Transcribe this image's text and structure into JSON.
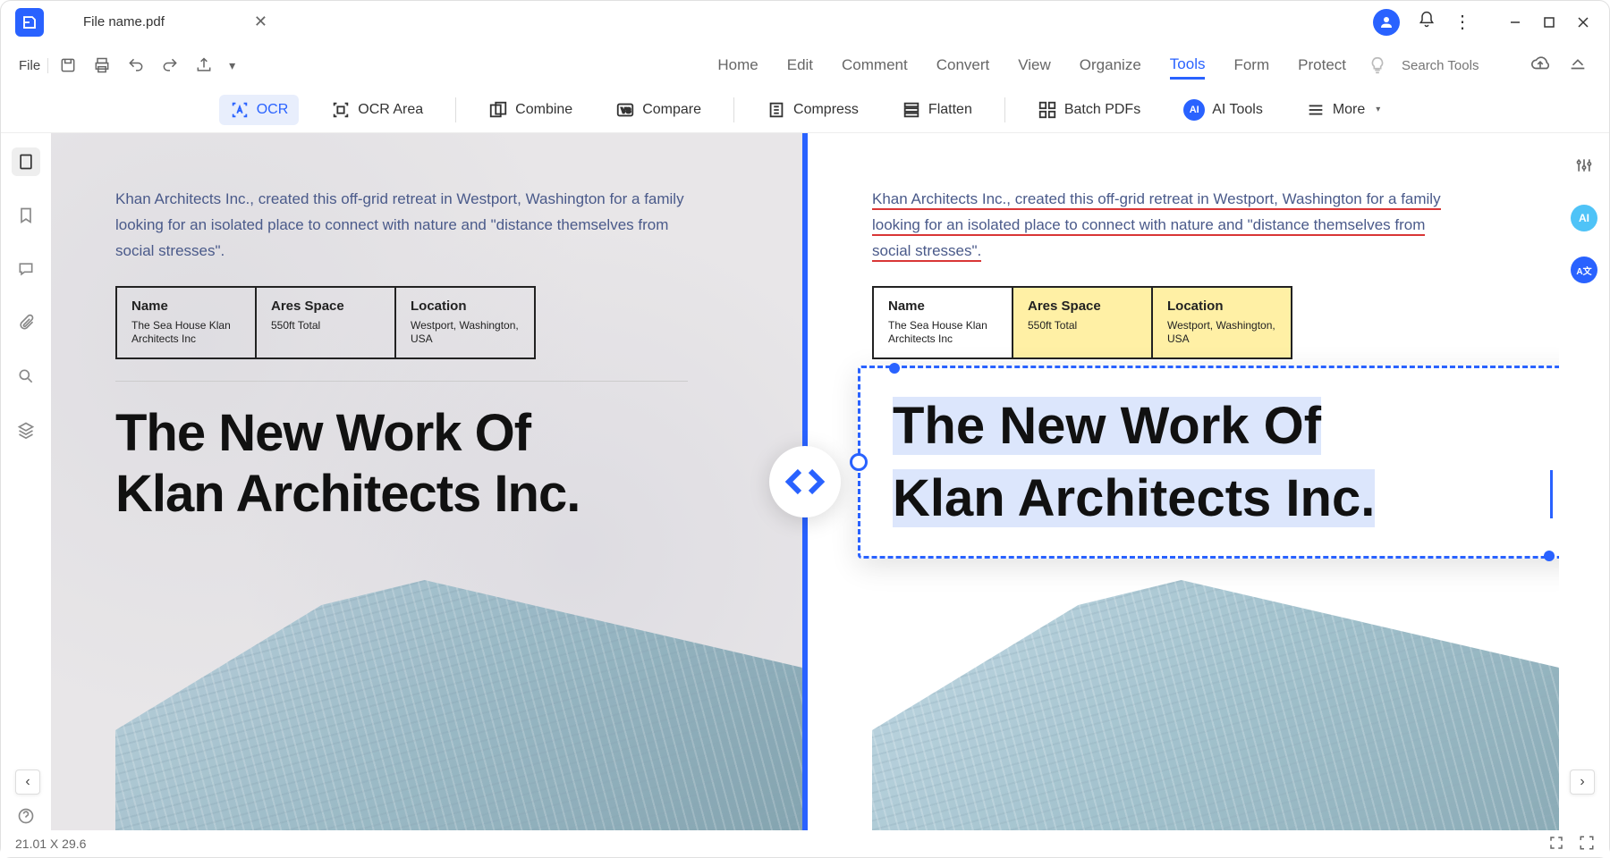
{
  "tab": {
    "filename": "File name.pdf"
  },
  "menubar": {
    "file": "File",
    "items": [
      "Home",
      "Edit",
      "Comment",
      "Convert",
      "View",
      "Organize",
      "Tools",
      "Form",
      "Protect"
    ],
    "active": "Tools",
    "search_placeholder": "Search Tools"
  },
  "toolbar": {
    "ocr": "OCR",
    "ocr_area": "OCR Area",
    "combine": "Combine",
    "compare": "Compare",
    "compress": "Compress",
    "flatten": "Flatten",
    "batch": "Batch PDFs",
    "ai_tools": "AI Tools",
    "more": "More"
  },
  "document": {
    "intro": "Khan Architects Inc., created this off-grid retreat in Westport, Washington for a family looking for an isolated place to connect with nature and \"distance themselves from social stresses\".",
    "table": {
      "col1_h": "Name",
      "col1_v": "The Sea House Klan Architects Inc",
      "col2_h": "Ares Space",
      "col2_v": "550ft Total",
      "col3_h": "Location",
      "col3_v": "Westport, Washington, USA"
    },
    "title_line1": "The New Work Of",
    "title_line2": "Klan Architects Inc."
  },
  "status": {
    "coords": "21.01 X 29.6"
  }
}
